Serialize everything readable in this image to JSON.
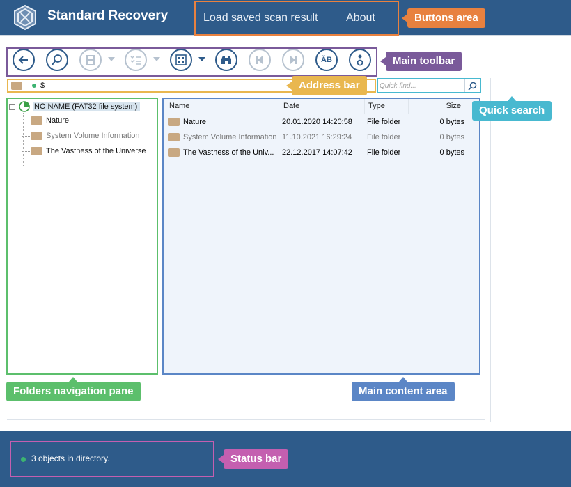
{
  "header": {
    "app_title": "Standard Recovery",
    "buttons": [
      "Load saved scan result",
      "About"
    ]
  },
  "toolbar": {
    "buttons": [
      {
        "icon": "back-arrow-icon",
        "enabled": true
      },
      {
        "icon": "scan-search-icon",
        "enabled": true
      },
      {
        "icon": "save-icon",
        "enabled": false,
        "dropdown": true
      },
      {
        "icon": "checklist-icon",
        "enabled": false,
        "dropdown": true
      },
      {
        "icon": "view-mode-icon",
        "enabled": true,
        "dropdown": true
      },
      {
        "icon": "binoculars-icon",
        "enabled": true
      },
      {
        "icon": "prev-icon",
        "enabled": false
      },
      {
        "icon": "next-icon",
        "enabled": false
      },
      {
        "icon": "encoding-icon",
        "label": "ÄB",
        "enabled": true
      },
      {
        "icon": "info-icon",
        "enabled": true
      }
    ]
  },
  "address": {
    "path": "$"
  },
  "quick_find": {
    "placeholder": "Quick find..."
  },
  "tree": {
    "root": "NO NAME (FAT32 file system)",
    "children": [
      "Nature",
      "System Volume Information",
      "The Vastness of the Universe"
    ]
  },
  "table": {
    "columns": [
      "Name",
      "Date",
      "Type",
      "Size"
    ],
    "rows": [
      {
        "name": "Nature",
        "date": "20.01.2020 14:20:58",
        "type": "File folder",
        "size": "0 bytes"
      },
      {
        "name": "System Volume Information",
        "date": "11.10.2021 16:29:24",
        "type": "File folder",
        "size": "0 bytes"
      },
      {
        "name": "The Vastness of the Univ...",
        "date": "22.12.2017 14:07:42",
        "type": "File folder",
        "size": "0 bytes"
      }
    ]
  },
  "status": {
    "text": "3 objects in directory."
  },
  "annotations": {
    "buttons_area": "Buttons area",
    "main_toolbar": "Main toolbar",
    "address_bar": "Address bar",
    "quick_search": "Quick search",
    "folders_pane": "Folders navigation pane",
    "main_content": "Main content area",
    "status_bar": "Status bar"
  },
  "colors": {
    "brand": "#2e5b8a",
    "buttons_area": "#e8813f",
    "main_toolbar": "#7a5a9a",
    "address_bar": "#e9b74f",
    "quick_search": "#48b9d0",
    "folders_pane": "#5cbf6c",
    "main_content": "#5b86c6",
    "status_bar": "#c45fb0"
  }
}
